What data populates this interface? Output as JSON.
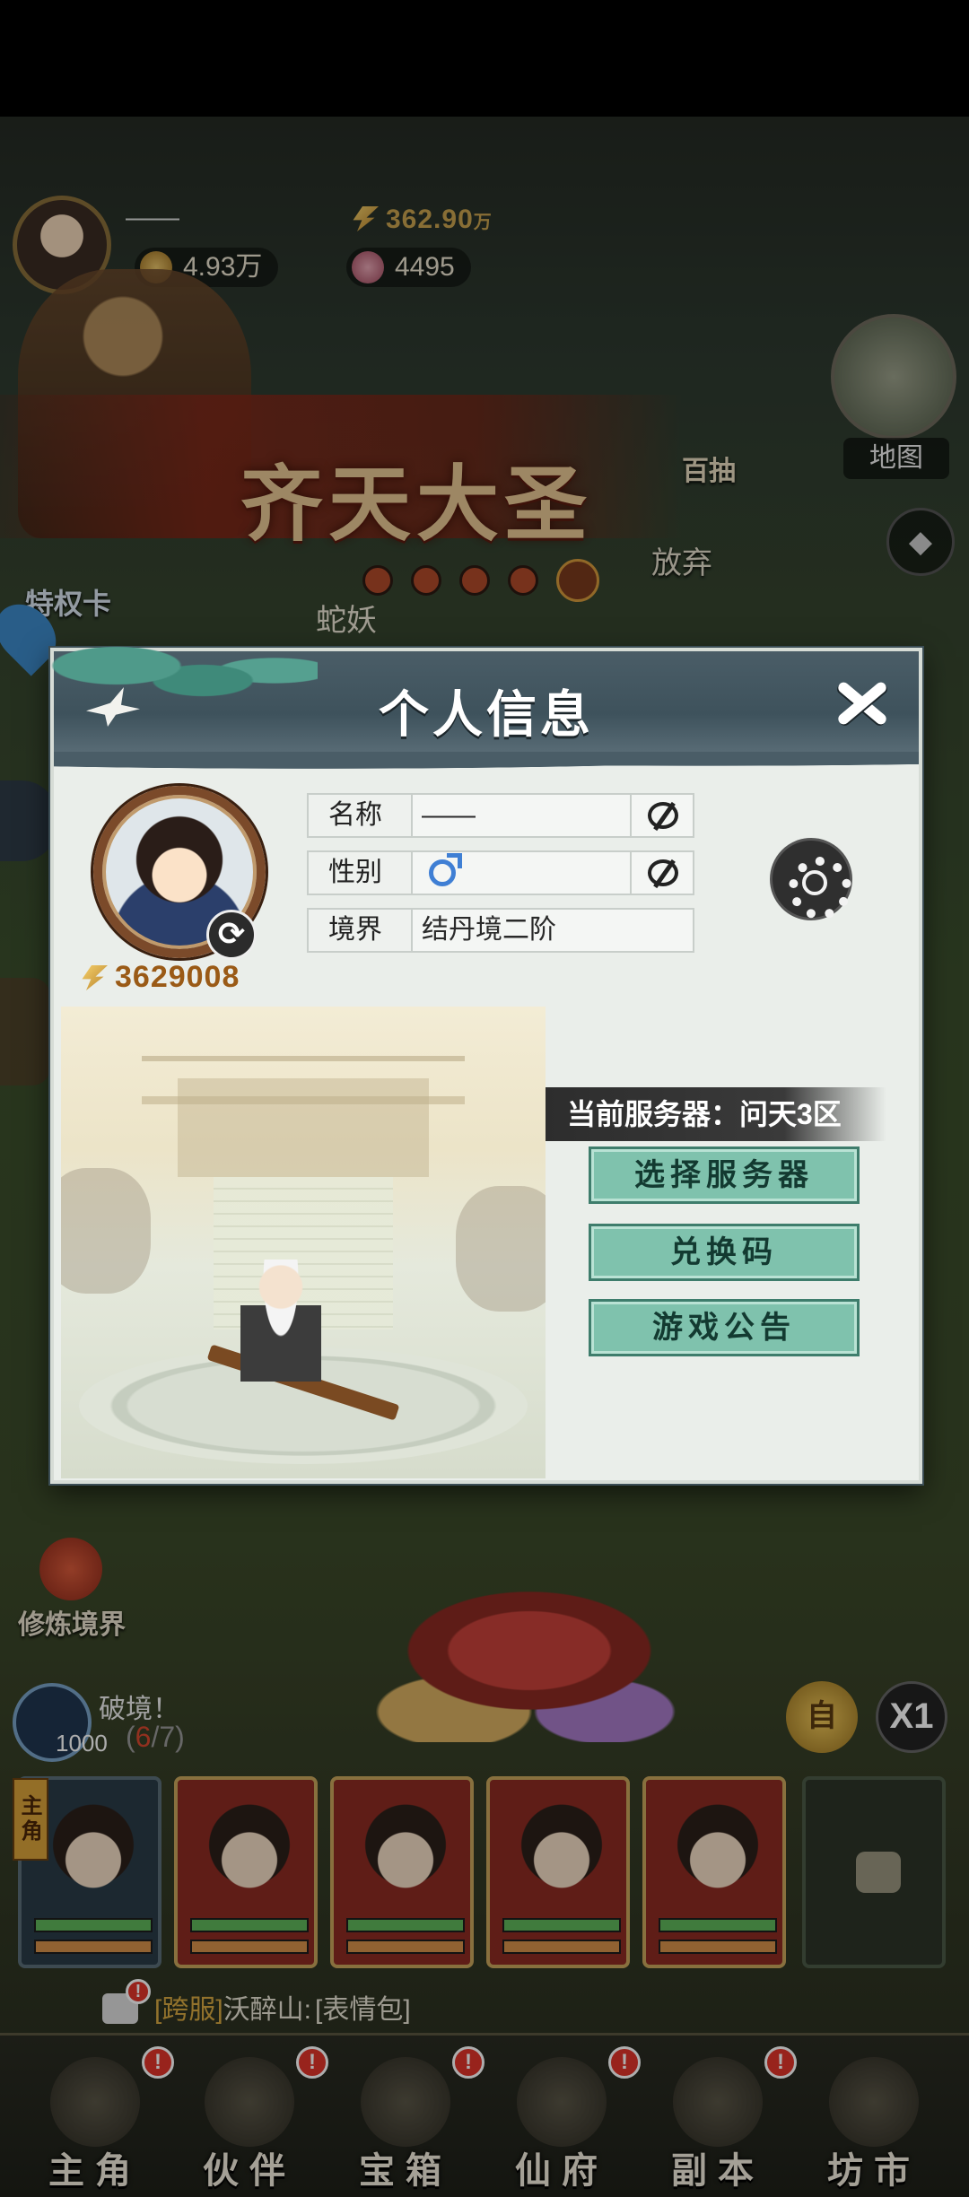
{
  "hud": {
    "player_name": "——",
    "currency_a": "4.93万",
    "currency_b": "4495",
    "gold_value": "362.90",
    "gold_unit": "万"
  },
  "banner": {
    "title": "齐天大圣"
  },
  "map": {
    "label": "地图"
  },
  "events": {
    "gacha_label": "百抽",
    "pass_label": "特权卡",
    "boss_name": "蛇妖",
    "give_up_label": "放弃"
  },
  "modal": {
    "title": "个人信息",
    "power": "3629008",
    "fields": [
      {
        "label": "名称",
        "value": "——"
      },
      {
        "label": "性别",
        "value": ""
      },
      {
        "label": "境界",
        "value": "结丹境二阶"
      }
    ],
    "server_label": "当前服务器：问天3区",
    "buttons": {
      "select_server": "选择服务器",
      "redeem_code": "兑换码",
      "announcement": "游戏公告"
    }
  },
  "side": {
    "cultivate_label": "修炼境界"
  },
  "breakthrough": {
    "label": "破境！",
    "count": "1000",
    "progress_open": "(",
    "progress_current": "6",
    "progress_rest": "/7)"
  },
  "controls": {
    "auto_label": "自",
    "speed_label": "X1"
  },
  "team": {
    "main_tag": "主角"
  },
  "chat": {
    "tag": "[跨服]",
    "sender": "沃醉山:",
    "message": "[表情包]"
  },
  "nav": {
    "items": [
      {
        "label": "主角"
      },
      {
        "label": "伙伴"
      },
      {
        "label": "宝箱"
      },
      {
        "label": "仙府"
      },
      {
        "label": "副本"
      },
      {
        "label": "坊市"
      }
    ],
    "badge": "!"
  }
}
